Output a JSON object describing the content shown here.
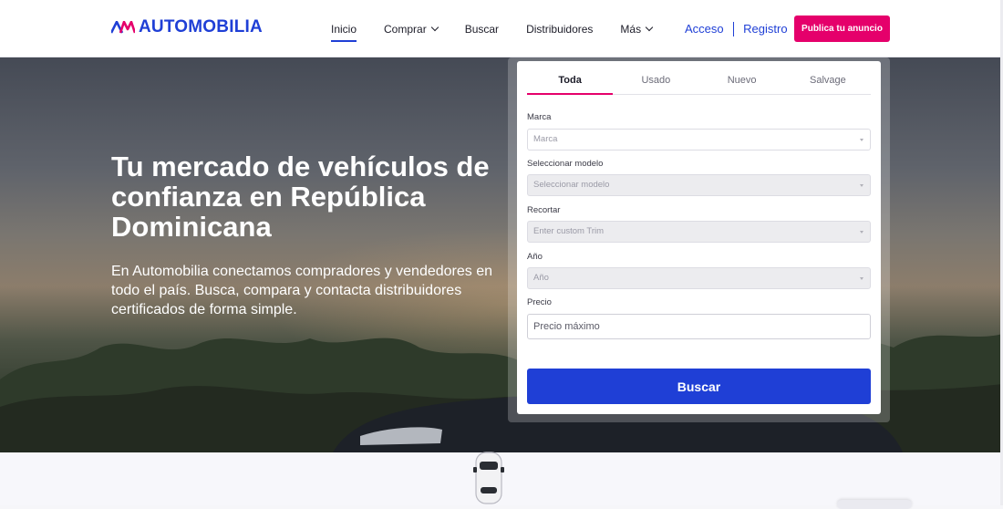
{
  "brand": {
    "name": "AUTOMOBILIA",
    "logo_icon": "am-logo-icon",
    "accent": "#1f3fd6",
    "cta_color": "#e5006b"
  },
  "nav": {
    "items": [
      {
        "label": "Inicio",
        "active": true
      },
      {
        "label": "Comprar",
        "dropdown": true
      },
      {
        "label": "Buscar"
      },
      {
        "label": "Distribuidores"
      },
      {
        "label": "Más",
        "dropdown": true
      }
    ]
  },
  "auth": {
    "login": "Acceso",
    "register": "Registro",
    "cta": "Publica tu anuncio"
  },
  "hero": {
    "title": "Tu mercado de vehículos de confianza en República Dominicana",
    "subtitle": "En Automobilia conectamos compradores y vendedores en todo el país. Busca, compara y contacta distribuidores certificados de forma simple."
  },
  "search": {
    "tabs": [
      "Toda",
      "Usado",
      "Nuevo",
      "Salvage"
    ],
    "active_tab": "Toda",
    "fields": {
      "make": {
        "label": "Marca",
        "placeholder": "Marca"
      },
      "model": {
        "label": "Seleccionar modelo",
        "placeholder": "Seleccionar modelo"
      },
      "trim": {
        "label": "Recortar",
        "placeholder": "Enter custom Trim"
      },
      "year": {
        "label": "Año",
        "placeholder": "Año"
      },
      "price": {
        "label": "Precio",
        "placeholder": "Precio máximo"
      }
    },
    "submit": "Buscar"
  }
}
